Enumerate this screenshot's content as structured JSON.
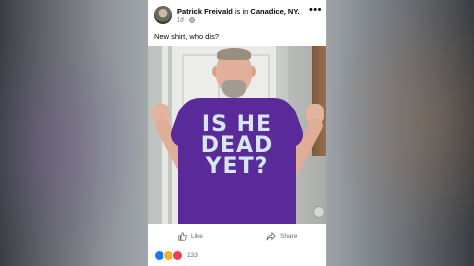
{
  "post": {
    "author": "Patrick Freivald",
    "location_prefix": "is in",
    "location": "Canadice, NY.",
    "timestamp": "1d",
    "privacy_icon": "globe-icon",
    "caption": "New shirt, who dis?",
    "shirt_text": [
      "IS HE",
      "DEAD",
      "YET?"
    ]
  },
  "actions": {
    "like_label": "Like",
    "share_label": "Share",
    "reaction_count": "133"
  },
  "colors": {
    "shirt": "#5a2a9a",
    "shirt_text": "#d7e7f2",
    "like_blue": "#1877f2",
    "love_red": "#f33e58",
    "haha_yellow": "#f7b125"
  }
}
